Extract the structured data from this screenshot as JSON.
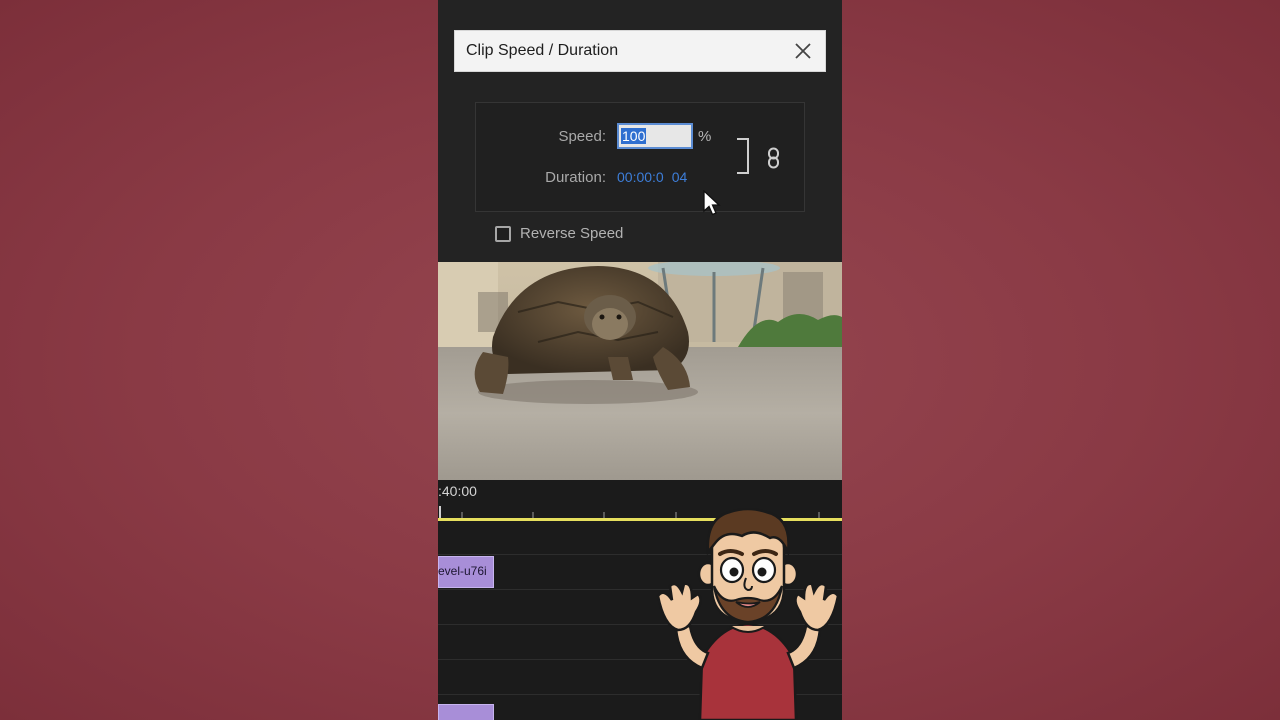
{
  "dialog": {
    "title": "Clip Speed / Duration",
    "speed_label": "Speed:",
    "speed_value": "100",
    "speed_unit": "%",
    "duration_label": "Duration:",
    "duration_value": "00:00:0",
    "duration_value_tail": "04",
    "reverse_speed_label": "Reverse Speed",
    "reverse_speed_checked": false
  },
  "timeline": {
    "timecode": ":40:00",
    "clips": [
      {
        "label": "evel-u76i"
      },
      {
        "label": ""
      }
    ]
  },
  "colors": {
    "background": "#8a3a45",
    "clip": "#a88ed8",
    "playhead": "#e6df5e",
    "duration_link": "#3d7ed9"
  }
}
